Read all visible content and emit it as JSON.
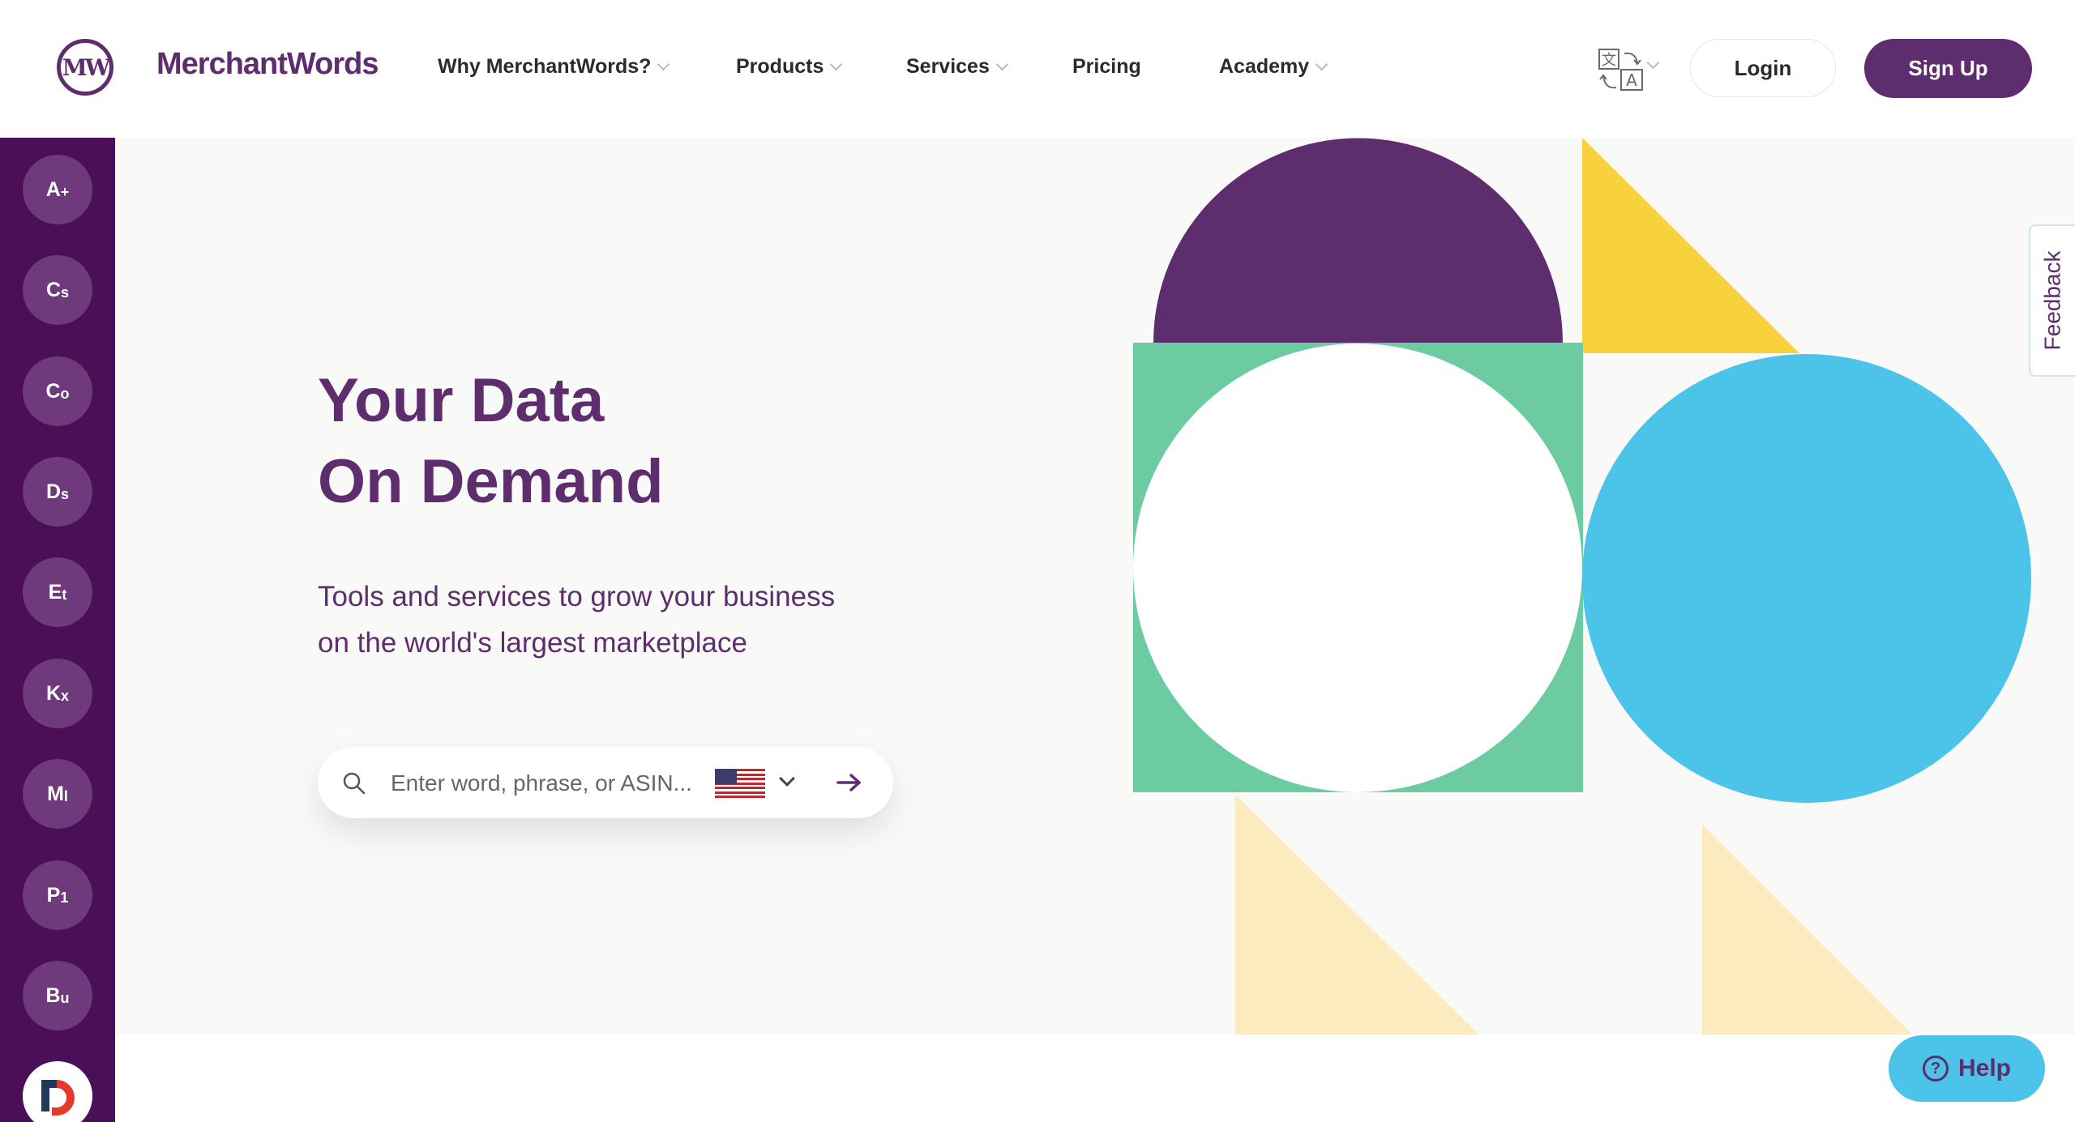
{
  "brand": {
    "logo_mark_text": "MW",
    "name": "MerchantWords"
  },
  "nav": {
    "items": [
      {
        "label": "Why MerchantWords?",
        "has_dropdown": true
      },
      {
        "label": "Products",
        "has_dropdown": true
      },
      {
        "label": "Services",
        "has_dropdown": true
      },
      {
        "label": "Pricing",
        "has_dropdown": false
      },
      {
        "label": "Academy",
        "has_dropdown": true
      }
    ],
    "language_icon": "translate-icon",
    "login_label": "Login",
    "signup_label": "Sign Up"
  },
  "sidebar": {
    "items": [
      {
        "main": "A",
        "sub": "+"
      },
      {
        "main": "C",
        "sub": "s"
      },
      {
        "main": "C",
        "sub": "o"
      },
      {
        "main": "D",
        "sub": "s"
      },
      {
        "main": "E",
        "sub": "t"
      },
      {
        "main": "K",
        "sub": "x"
      },
      {
        "main": "M",
        "sub": "l"
      },
      {
        "main": "P",
        "sub": "1"
      },
      {
        "main": "B",
        "sub": "u"
      }
    ]
  },
  "hero": {
    "title_line1": "Your Data",
    "title_line2": "On Demand",
    "subtitle_line1": "Tools and services to grow your business",
    "subtitle_line2": "on the world's largest marketplace",
    "search": {
      "placeholder": "Enter word, phrase, or ASIN...",
      "value": "",
      "marketplace_flag": "us-flag-icon"
    }
  },
  "feedback": {
    "label": "Feedback"
  },
  "help": {
    "label": "Help"
  },
  "colors": {
    "brand_purple": "#5e2d6e",
    "sidebar_purple": "#4a0f57",
    "green": "#6ccba0",
    "yellow": "#f8d13c",
    "pale_yellow": "#fdebc0",
    "blue": "#4cc3e8"
  }
}
